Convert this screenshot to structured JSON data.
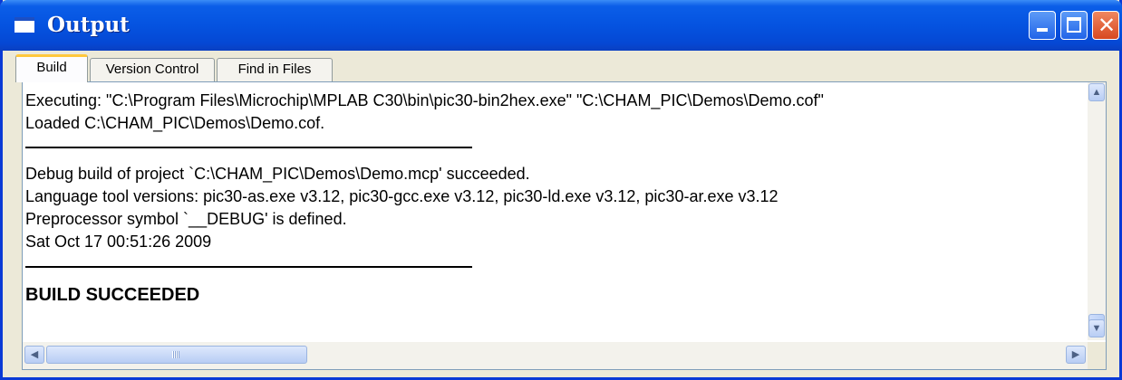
{
  "window": {
    "title": "Output",
    "icon": "output-window-icon",
    "controls": {
      "minimize": "minimize-icon",
      "maximize": "maximize-icon",
      "close": "✕"
    }
  },
  "tabs": [
    {
      "label": "Build",
      "active": true
    },
    {
      "label": "Version Control",
      "active": false
    },
    {
      "label": "Find in Files",
      "active": false
    }
  ],
  "output": {
    "lines": [
      "Executing: \"C:\\Program Files\\Microchip\\MPLAB C30\\bin\\pic30-bin2hex.exe\" \"C:\\CHAM_PIC\\Demos\\Demo.cof\"",
      "Loaded C:\\CHAM_PIC\\Demos\\Demo.cof.",
      "Debug build of project `C:\\CHAM_PIC\\Demos\\Demo.mcp' succeeded.",
      "Language tool versions: pic30-as.exe v3.12, pic30-gcc.exe v3.12, pic30-ld.exe v3.12, pic30-ar.exe v3.12",
      "Preprocessor symbol `__DEBUG' is defined.",
      "Sat Oct 17 00:51:26 2009",
      "BUILD SUCCEEDED"
    ]
  },
  "scrollbars": {
    "up": "▲",
    "down": "▼",
    "left": "◀",
    "right": "▶"
  },
  "colors": {
    "titlebar": "#0553e0",
    "active_tab_accent": "#ffc83c",
    "window_bg": "#ece9d8"
  }
}
